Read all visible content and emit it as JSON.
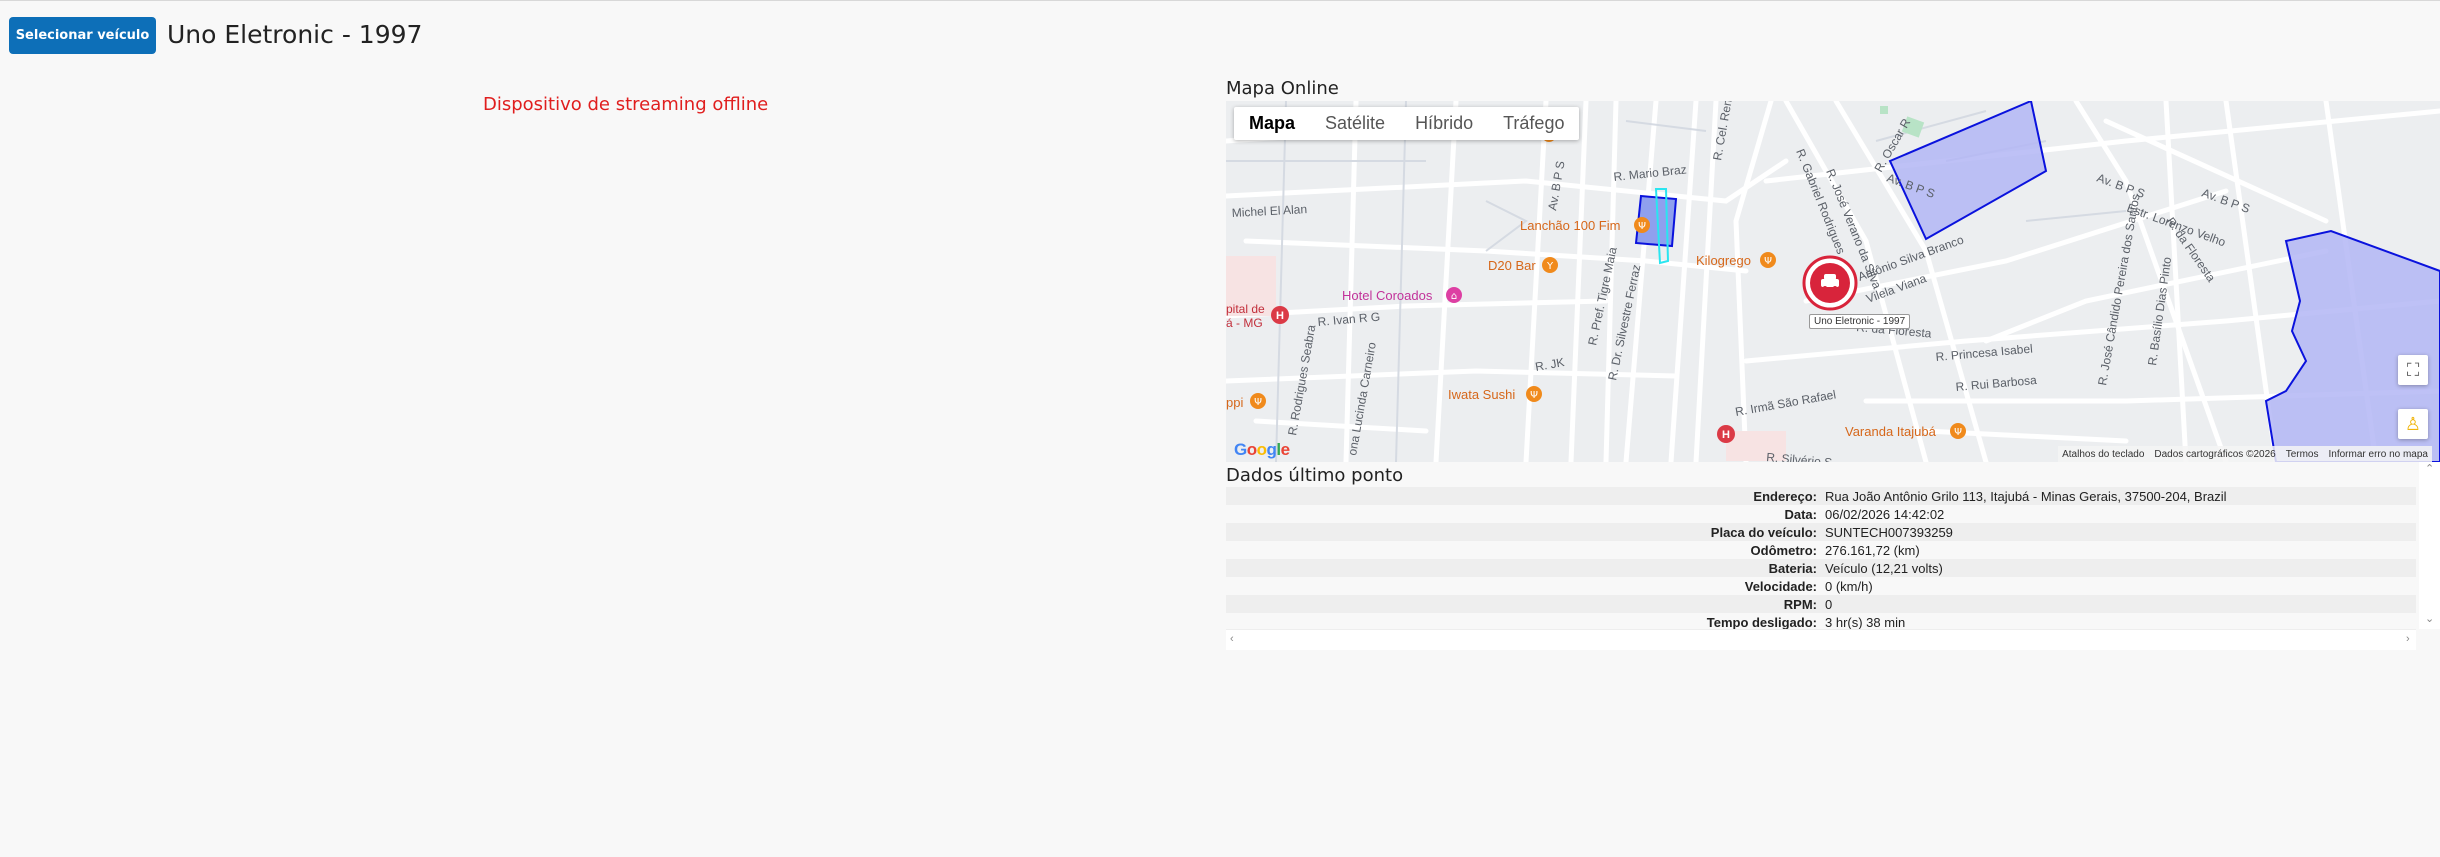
{
  "header": {
    "select_button": "Selecionar veículo",
    "vehicle_title": "Uno Eletronic - 1997"
  },
  "stream": {
    "status_text": "Dispositivo de streaming offline"
  },
  "map": {
    "title": "Mapa Online",
    "types": [
      "Mapa",
      "Satélite",
      "Híbrido",
      "Tráfego"
    ],
    "active_type": "Mapa",
    "car_label": "Uno Eletronic - 1997",
    "google_logo": "Google",
    "attribution": {
      "shortcuts": "Atalhos do teclado",
      "data": "Dados cartográficos ©2026",
      "terms": "Termos",
      "report": "Informar erro no mapa"
    },
    "places": [
      {
        "name": "Lanchão 100 Fim",
        "kind": "restaurant"
      },
      {
        "name": "D20 Bar",
        "kind": "bar"
      },
      {
        "name": "Kilogrego",
        "kind": "restaurant"
      },
      {
        "name": "Hotel Coroados",
        "kind": "hotel"
      },
      {
        "name": "Iwata Sushi",
        "kind": "restaurant"
      },
      {
        "name": "Varanda Itajubá",
        "kind": "restaurant"
      },
      {
        "name": "pital de\ná - MG",
        "kind": "hospital"
      },
      {
        "name": "ppi",
        "kind": "restaurant"
      }
    ],
    "streets": [
      "R. Mario Braz",
      "Av. B P S",
      "R. Cel. Ren",
      "R. Gabriel Rodrigues",
      "R. José Verano da Silva",
      "Av. B P S",
      "Michel El Alan",
      "R. Ivan R G",
      "R. Rodrigues Seabra",
      "ona Lucinda Carneiro",
      "R. Pref. Tigre Maia",
      "R. Dr. Silvestre Ferraz",
      "R. JK",
      "R. Irmã São Rafael",
      "R. Antônio Silva Branco",
      "Estr. Lorenzo Velho",
      "R. da Floresta",
      "R. Princesa Isabel",
      "R. Rui Barbosa",
      "R. José Cândido Pereira dos Santos",
      "R. Basílio Dias Pinto",
      "R. Oscar R",
      "R. Silvério S",
      "Av. B P S",
      "Av. B P S",
      "R. da Floresta",
      "Vilela Viana"
    ],
    "colors": {
      "zone": "#0a12dd",
      "zone_fill": "#b3b6f4",
      "car": "#d8243b",
      "poi_orange": "#f08a1c",
      "poi_pink": "#dd3fa3",
      "poi_red": "#db3a46"
    }
  },
  "last_point": {
    "title": "Dados último ponto",
    "rows": [
      {
        "label": "Endereço:",
        "value": "Rua João Antônio Grilo 113, Itajubá - Minas Gerais, 37500-204, Brazil"
      },
      {
        "label": "Data:",
        "value": "06/02/2026 14:42:02"
      },
      {
        "label": "Placa do veículo:",
        "value": "SUNTECH007393259"
      },
      {
        "label": "Odômetro:",
        "value": "276.161,72 (km)"
      },
      {
        "label": "Bateria:",
        "value": "Veículo (12,21 volts)"
      },
      {
        "label": "Velocidade:",
        "value": "0 (km/h)"
      },
      {
        "label": "RPM:",
        "value": "0"
      },
      {
        "label": "Tempo desligado:",
        "value": "3 hr(s) 38 min"
      }
    ]
  }
}
